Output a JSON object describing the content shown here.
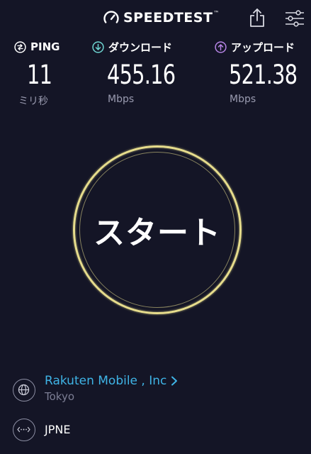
{
  "header": {
    "logo_text": "SPEEDTEST",
    "logo_icon": "speedometer-icon",
    "share_icon": "share-icon",
    "settings_icon": "settings-sliders-icon"
  },
  "metrics": {
    "ping": {
      "label": "PING",
      "value": "11",
      "unit": "ミリ秒",
      "icon": "ping-icon",
      "color": "#ffffff"
    },
    "download": {
      "label": "ダウンロード",
      "value": "455.16",
      "unit": "Mbps",
      "icon": "download-arrow-icon",
      "color": "#6fd7d3"
    },
    "upload": {
      "label": "アップロード",
      "value": "521.38",
      "unit": "Mbps",
      "icon": "upload-arrow-icon",
      "color": "#b785e6"
    }
  },
  "start_button": {
    "label": "スタート",
    "ring_color": "#e6dc8c"
  },
  "provider": {
    "name": "Rakuten Mobile , Inc",
    "location": "Tokyo",
    "icon": "globe-icon",
    "color": "#3fb4e6"
  },
  "server": {
    "name": "JPNE",
    "icon": "server-icon"
  },
  "colors": {
    "background": "#141526",
    "muted": "#9a9bb0"
  }
}
